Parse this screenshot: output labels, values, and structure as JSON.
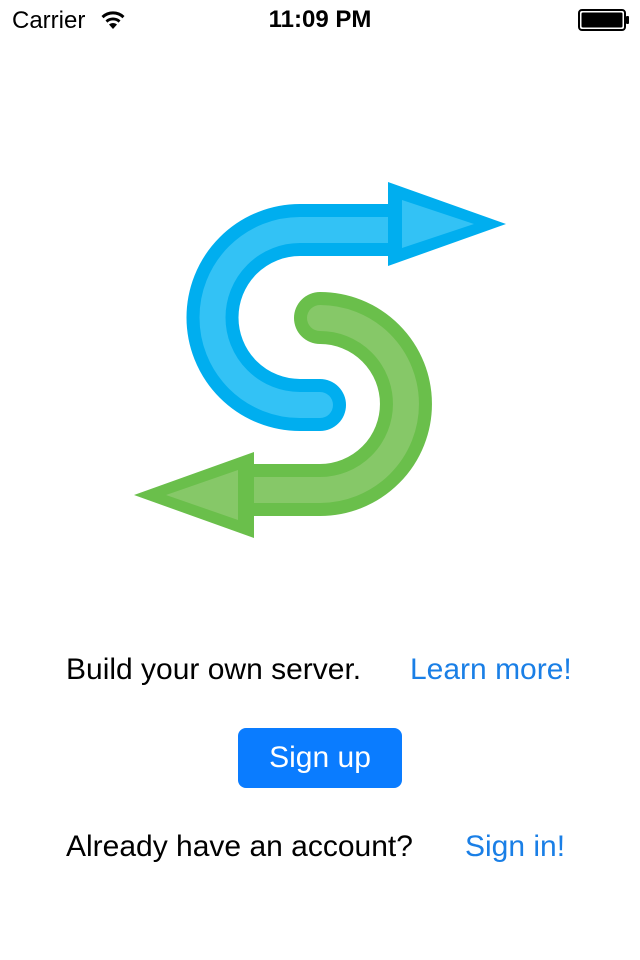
{
  "status_bar": {
    "carrier": "Carrier",
    "time": "11:09 PM",
    "wifi_icon": "wifi-icon",
    "battery_icon": "battery-icon"
  },
  "logo": {
    "icon": "s-arrows-logo",
    "colors": {
      "blue_outer": "#00aeef",
      "blue_inner": "#33c2f5",
      "green_outer": "#6abf4b",
      "green_inner": "#86c868"
    }
  },
  "main": {
    "tagline": "Build your own server.",
    "learn_more_link": "Learn more!",
    "signup_button_label": "Sign up",
    "account_question": "Already have an account?",
    "sign_in_link": "Sign in!"
  },
  "colors": {
    "link": "#1a7fe6",
    "button_bg": "#0a7cff",
    "button_text": "#ffffff"
  }
}
